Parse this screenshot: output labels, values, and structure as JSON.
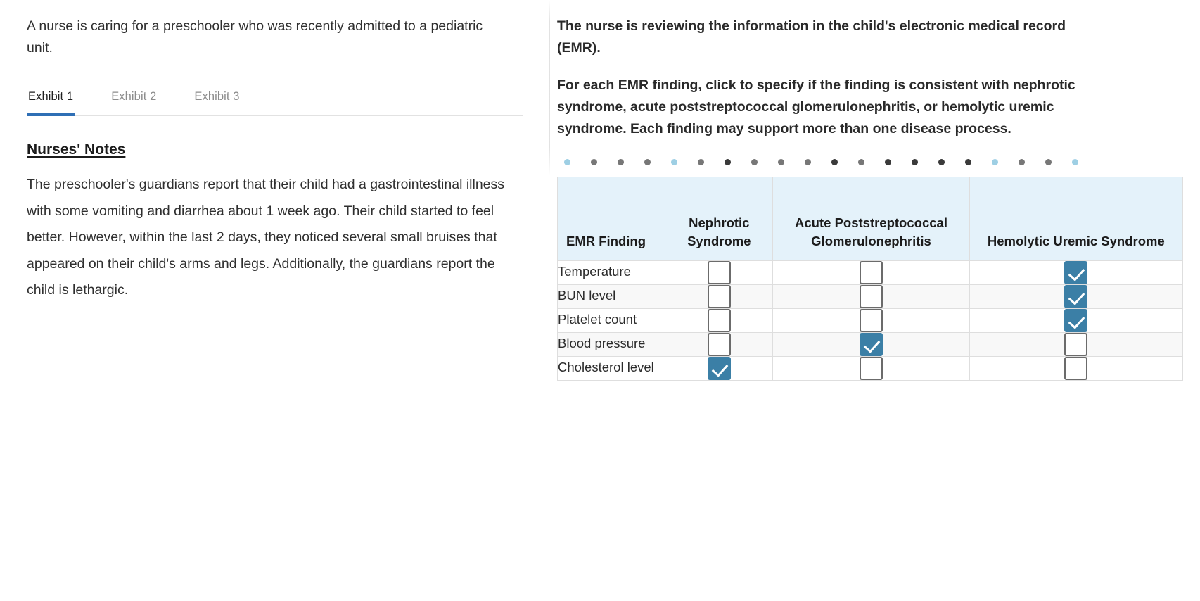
{
  "left": {
    "stem": "A nurse is caring for a preschooler who was recently admitted to a pediatric unit.",
    "tabs": [
      {
        "label": "Exhibit 1",
        "active": true
      },
      {
        "label": "Exhibit 2",
        "active": false
      },
      {
        "label": "Exhibit 3",
        "active": false
      }
    ],
    "section_title": "Nurses' Notes",
    "notes": "The preschooler's guardians report that their child had a gastrointestinal illness with some vomiting and diarrhea about 1 week ago. Their child started to feel better. However, within the last 2 days, they noticed several small bruises that appeared on their child's arms and legs. Additionally, the guardians report the child is lethargic."
  },
  "right": {
    "prompt_1": "The nurse is reviewing the information in the child's electronic medical record (EMR).",
    "prompt_2": "For each EMR finding, click to specify if the finding is consistent with nephrotic syndrome, acute poststreptococcal glomerulonephritis, or hemolytic uremic syndrome. Each finding may support more than one disease process.",
    "dot_colors": [
      "#9ecfe4",
      "#777777",
      "#777777",
      "#777777",
      "#9ecfe4",
      "#777777",
      "#3a3a3a",
      "#777777",
      "#777777",
      "#777777",
      "#3a3a3a",
      "#777777",
      "#3a3a3a",
      "#3a3a3a",
      "#3a3a3a",
      "#3a3a3a",
      "#9ecfe4",
      "#777777",
      "#777777",
      "#9ecfe4",
      "#777777",
      "#3a3a3a",
      "#9ecfe4",
      "#777777",
      "#777777",
      "#3a3a3a"
    ],
    "table": {
      "headers": [
        "EMR Finding",
        "Nephrotic Syndrome",
        "Acute Poststreptococcal Glomerulonephritis",
        "Hemolytic Uremic Syndrome"
      ],
      "rows": [
        {
          "finding": "Temperature",
          "checks": [
            false,
            false,
            true
          ]
        },
        {
          "finding": "BUN level",
          "checks": [
            false,
            false,
            true
          ]
        },
        {
          "finding": "Platelet count",
          "checks": [
            false,
            false,
            true
          ]
        },
        {
          "finding": "Blood pressure",
          "checks": [
            false,
            true,
            false
          ]
        },
        {
          "finding": "Cholesterol level",
          "checks": [
            true,
            false,
            false
          ]
        }
      ]
    }
  },
  "colors": {
    "accent_blue": "#2f6fb5",
    "header_bg": "#e4f2fa",
    "checkbox_checked": "#3b7fa6",
    "checkbox_border": "#6b6b6b"
  }
}
